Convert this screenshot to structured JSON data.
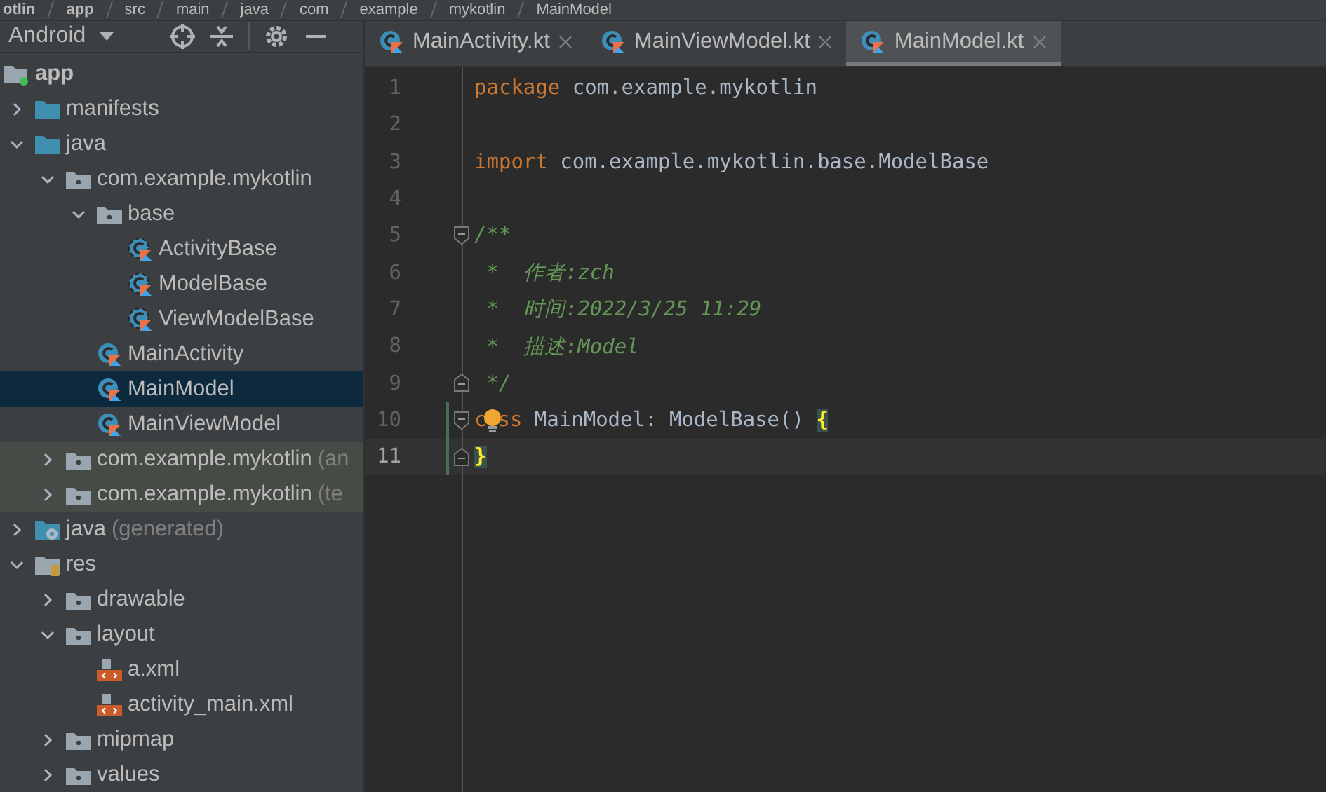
{
  "breadcrumbs": [
    "otlin",
    "app",
    "src",
    "main",
    "java",
    "com",
    "example",
    "mykotlin",
    "MainModel"
  ],
  "project_panel": {
    "view_selector": "Android"
  },
  "tree": [
    {
      "label": "app",
      "kind": "module",
      "selected": false,
      "tinted": false,
      "children": [
        {
          "label": "manifests",
          "kind": "folder",
          "expanded": false,
          "selected": false,
          "tinted": false
        },
        {
          "label": "java",
          "kind": "folder",
          "expanded": true,
          "selected": false,
          "tinted": false,
          "children": [
            {
              "label": "com.example.mykotlin",
              "kind": "package",
              "expanded": true,
              "selected": false,
              "tinted": false,
              "children": [
                {
                  "label": "base",
                  "kind": "package",
                  "expanded": true,
                  "selected": false,
                  "tinted": false,
                  "children": [
                    {
                      "label": "ActivityBase",
                      "kind": "kotlin-open-class",
                      "selected": false,
                      "tinted": false
                    },
                    {
                      "label": "ModelBase",
                      "kind": "kotlin-open-class",
                      "selected": false,
                      "tinted": false
                    },
                    {
                      "label": "ViewModelBase",
                      "kind": "kotlin-open-class",
                      "selected": false,
                      "tinted": false
                    }
                  ]
                },
                {
                  "label": "MainActivity",
                  "kind": "kotlin-class",
                  "selected": false,
                  "tinted": false
                },
                {
                  "label": "MainModel",
                  "kind": "kotlin-class",
                  "selected": true,
                  "tinted": false
                },
                {
                  "label": "MainViewModel",
                  "kind": "kotlin-class",
                  "selected": false,
                  "tinted": false
                }
              ]
            },
            {
              "label": "com.example.mykotlin",
              "suffix": "(an",
              "kind": "package",
              "expanded": false,
              "selected": false,
              "tinted": true
            },
            {
              "label": "com.example.mykotlin",
              "suffix": "(te",
              "kind": "package",
              "expanded": false,
              "selected": false,
              "tinted": true
            }
          ]
        },
        {
          "label": "java",
          "suffix": "(generated)",
          "kind": "generated-folder",
          "expanded": false,
          "selected": false,
          "tinted": false
        },
        {
          "label": "res",
          "kind": "res-folder",
          "expanded": true,
          "selected": false,
          "tinted": false,
          "children": [
            {
              "label": "drawable",
              "kind": "package",
              "expanded": false,
              "selected": false,
              "tinted": false
            },
            {
              "label": "layout",
              "kind": "package",
              "expanded": true,
              "selected": false,
              "tinted": false,
              "children": [
                {
                  "label": "a.xml",
                  "kind": "xml",
                  "selected": false,
                  "tinted": false
                },
                {
                  "label": "activity_main.xml",
                  "kind": "xml",
                  "selected": false,
                  "tinted": false
                }
              ]
            },
            {
              "label": "mipmap",
              "kind": "package",
              "expanded": false,
              "selected": false,
              "tinted": false
            },
            {
              "label": "values",
              "kind": "package",
              "expanded": false,
              "selected": false,
              "tinted": false
            }
          ]
        }
      ]
    }
  ],
  "tabs": [
    {
      "label": "MainActivity.kt",
      "selected": false
    },
    {
      "label": "MainViewModel.kt",
      "selected": false
    },
    {
      "label": "MainModel.kt",
      "selected": true
    }
  ],
  "code": [
    {
      "number": "1",
      "tokens": [
        {
          "kind": "keyword",
          "text": "package"
        },
        {
          "kind": "plain",
          "text": " com.example.mykotlin"
        }
      ]
    },
    {
      "number": "2"
    },
    {
      "number": "3",
      "tokens": [
        {
          "kind": "keyword",
          "text": "import"
        },
        {
          "kind": "plain",
          "text": " com.example.mykotlin.base.ModelBase"
        }
      ]
    },
    {
      "number": "4"
    },
    {
      "number": "5",
      "fold_start": true,
      "tokens": [
        {
          "kind": "comment",
          "text": "/**"
        }
      ]
    },
    {
      "number": "6",
      "tokens": [
        {
          "kind": "comment",
          "text": " *  作者:zch"
        }
      ]
    },
    {
      "number": "7",
      "tokens": [
        {
          "kind": "comment",
          "text": " *  时间:2022/3/25 11:29"
        }
      ]
    },
    {
      "number": "8",
      "tokens": [
        {
          "kind": "comment",
          "text": " *  描述:Model"
        }
      ]
    },
    {
      "number": "9",
      "fold_end": true,
      "tokens": [
        {
          "kind": "comment",
          "text": " */"
        }
      ]
    },
    {
      "number": "10",
      "fold_start": true,
      "changed": true,
      "current": false,
      "tokens": [
        {
          "kind": "keyword",
          "text": "c"
        },
        {
          "kind": "bulb"
        },
        {
          "kind": "keyword",
          "text": "ss"
        },
        {
          "kind": "plain",
          "text": " MainModel: ModelBase() "
        },
        {
          "kind": "brace",
          "text": "{"
        }
      ]
    },
    {
      "number": "11",
      "fold_end": true,
      "changed": true,
      "current": true,
      "tokens": [
        {
          "kind": "brace",
          "text": "}"
        }
      ]
    }
  ]
}
